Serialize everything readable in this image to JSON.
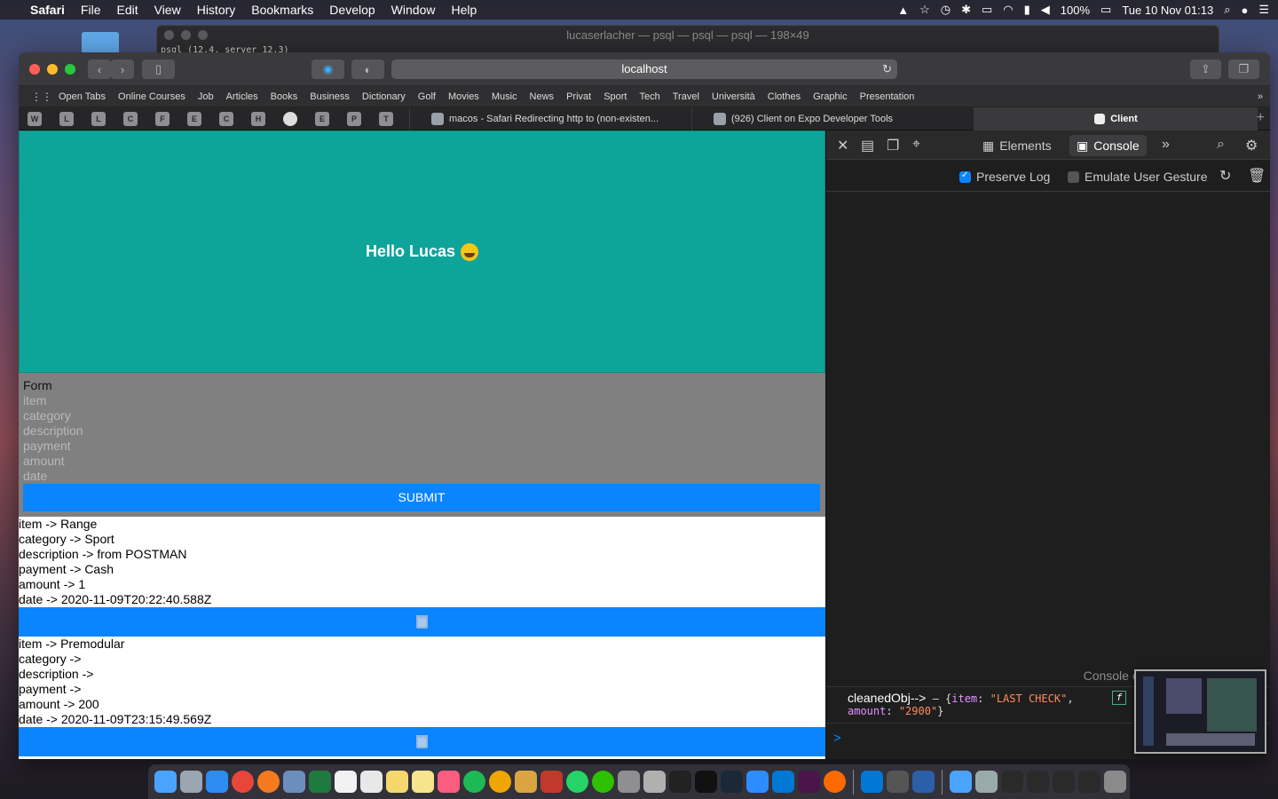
{
  "menubar": {
    "app": "Safari",
    "items": [
      "File",
      "Edit",
      "View",
      "History",
      "Bookmarks",
      "Develop",
      "Window",
      "Help"
    ],
    "battery": "100%",
    "datetime": "Tue 10 Nov  01:13"
  },
  "terminal": {
    "title": "lucaserlacher — psql — psql — psql — 198×49",
    "subtitle": "psql (12.4, server 12.3)"
  },
  "toolbar": {
    "url": "localhost"
  },
  "favorites": [
    "Open Tabs",
    "Online Courses",
    "Job",
    "Articles",
    "Books",
    "Business",
    "Dictionary",
    "Golf",
    "Movies",
    "Music",
    "News",
    "Privat",
    "Sport",
    "Tech",
    "Travel",
    "Università",
    "Clothes",
    "Graphic",
    "Presentation"
  ],
  "pinned_tabs": [
    "W",
    "L",
    "L",
    "C",
    "F",
    "E",
    "C",
    "H",
    "",
    "E",
    "P",
    "T"
  ],
  "tabs": [
    {
      "label": "macos - Safari Redirecting http to (non-existen..."
    },
    {
      "label": "(926) Client on Expo Developer Tools"
    },
    {
      "label": "Client"
    }
  ],
  "app": {
    "greeting": "Hello Lucas",
    "form_title": "Form",
    "fields": {
      "item": "item",
      "category": "category",
      "description": "description",
      "payment": "payment",
      "amount": "amount",
      "date": "date"
    },
    "submit_label": "SUBMIT",
    "records": [
      {
        "item": "item -> Range",
        "category": "category -> Sport",
        "description": "description -> from POSTMAN",
        "payment": "payment -> Cash",
        "amount": "amount -> 1",
        "date": "date -> 2020-11-09T20:22:40.588Z"
      },
      {
        "item": "item -> Premodular",
        "category": "category -> ",
        "description": "description -> ",
        "payment": "payment -> ",
        "amount": "amount -> 200",
        "date": "date -> 2020-11-09T23:15:49.569Z"
      }
    ]
  },
  "devtools": {
    "tab_elements": "Elements",
    "tab_console": "Console",
    "preserve_log": "Preserve Log",
    "emulate_gesture": "Emulate User Gesture",
    "cleared_msg": "Console cleared at 1:11:24 AM",
    "log_label": "cleanedObj-->",
    "log_dash": "–",
    "log_item_key": "item",
    "log_item_val": "\"LAST CHECK\"",
    "log_amount_key": "amount",
    "log_amount_val": "\"2900\"",
    "fn_badge": "f",
    "prompt": ">"
  },
  "colors": {
    "hero": "#0ea49a",
    "form_bg": "#808080",
    "accent": "#0a84ff"
  }
}
